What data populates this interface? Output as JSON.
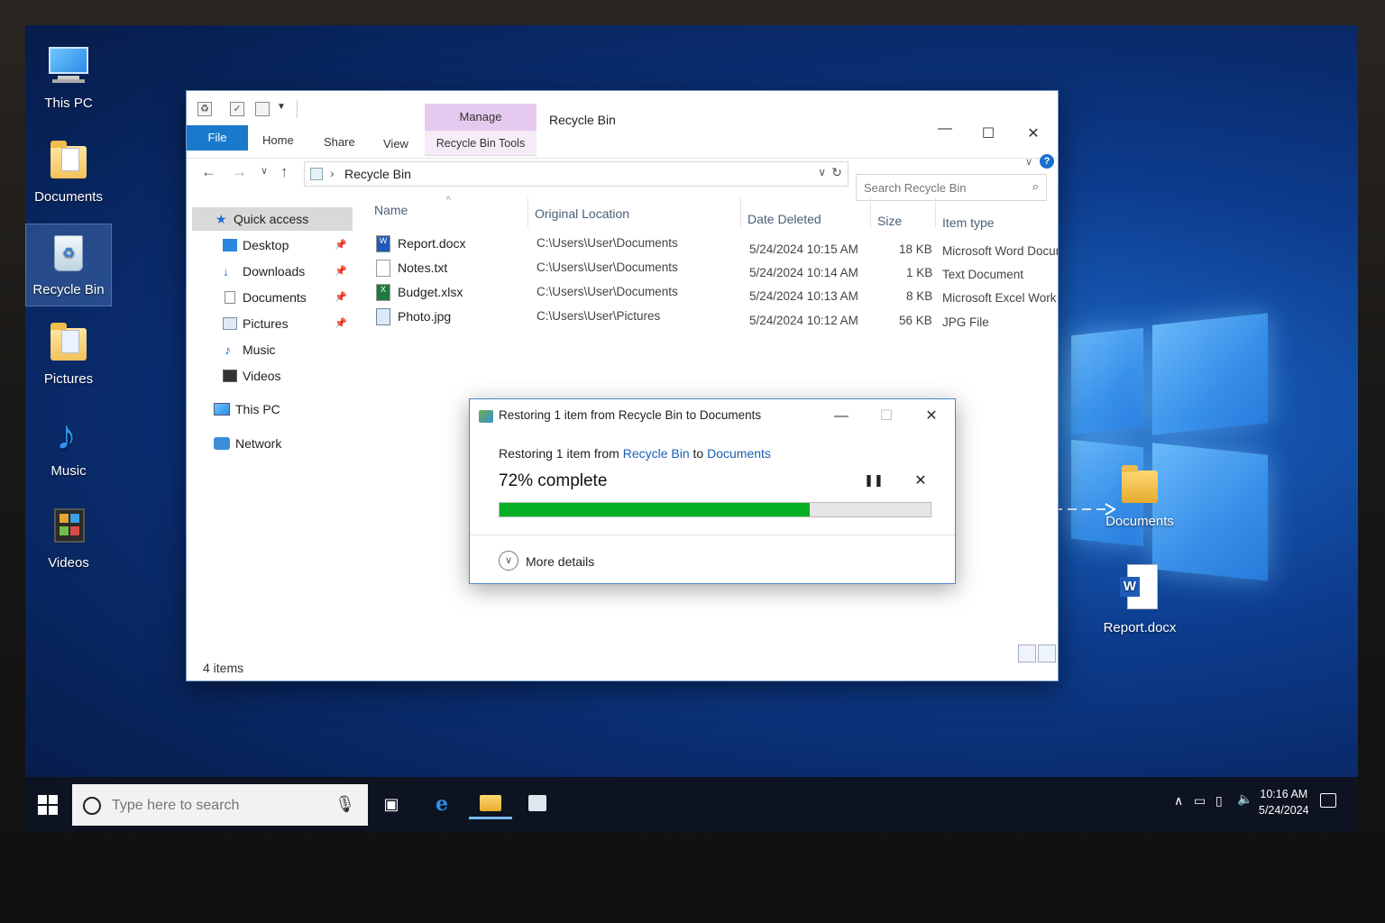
{
  "desktop": {
    "icons": [
      {
        "label": "This PC"
      },
      {
        "label": "Documents"
      },
      {
        "label": "Recycle Bin"
      },
      {
        "label": "Pictures"
      },
      {
        "label": "Music"
      },
      {
        "label": "Videos"
      }
    ],
    "right_icons": [
      {
        "label": "Documents"
      },
      {
        "label": "Report.docx"
      }
    ]
  },
  "explorer": {
    "title": "Recycle Bin",
    "manage_tab": "Manage",
    "tools_tab": "Recycle Bin Tools",
    "ribbon": {
      "file": "File",
      "home": "Home",
      "share": "Share",
      "view": "View"
    },
    "address": "Recycle Bin",
    "search_placeholder": "Search Recycle Bin",
    "nav": {
      "quick_access": "Quick access",
      "items": [
        {
          "label": "Desktop"
        },
        {
          "label": "Downloads"
        },
        {
          "label": "Documents"
        },
        {
          "label": "Pictures"
        },
        {
          "label": "Music"
        },
        {
          "label": "Videos"
        }
      ],
      "this_pc": "This PC",
      "network": "Network"
    },
    "columns": {
      "name": "Name",
      "location": "Original Location",
      "date": "Date Deleted",
      "size": "Size",
      "type": "Item type"
    },
    "rows": [
      {
        "name": "Report.docx",
        "location": "C:\\Users\\User\\Documents",
        "date": "5/24/2024 10:15 AM",
        "size": "18 KB",
        "type": "Microsoft Word Docum"
      },
      {
        "name": "Notes.txt",
        "location": "C:\\Users\\User\\Documents",
        "date": "5/24/2024 10:14 AM",
        "size": "1 KB",
        "type": "Text Document"
      },
      {
        "name": "Budget.xlsx",
        "location": "C:\\Users\\User\\Documents",
        "date": "5/24/2024 10:13 AM",
        "size": "8 KB",
        "type": "Microsoft Excel Work"
      },
      {
        "name": "Photo.jpg",
        "location": "C:\\Users\\User\\Pictures",
        "date": "5/24/2024 10:12 AM",
        "size": "56 KB",
        "type": "JPG File"
      }
    ],
    "status": "4 items"
  },
  "dialog": {
    "title": "Restoring 1 item from Recycle Bin to Documents",
    "line_prefix": "Restoring 1 item from",
    "line_source": "Recycle Bin",
    "line_mid": "to",
    "line_dest": "Documents",
    "percent_text": "72% complete",
    "progress": 0.72,
    "more_details": "More details"
  },
  "taskbar": {
    "search_placeholder": "Type here to search",
    "time": "10:16 AM",
    "date": "5/24/2024"
  }
}
